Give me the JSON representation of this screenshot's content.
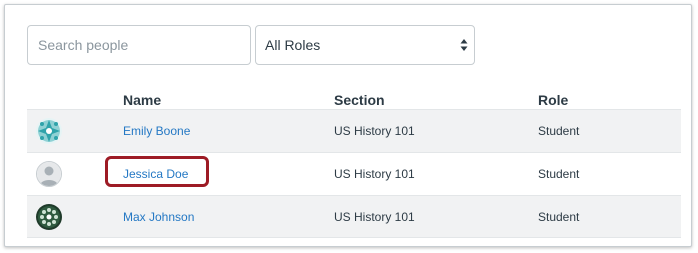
{
  "search": {
    "placeholder": "Search people",
    "value": ""
  },
  "role_filter": {
    "selected": "All Roles"
  },
  "table": {
    "headers": {
      "name": "Name",
      "section": "Section",
      "role": "Role"
    },
    "rows": [
      {
        "avatar": "avatar-teal-pattern-icon",
        "name": "Emily Boone",
        "section": "US History 101",
        "role": "Student"
      },
      {
        "avatar": "avatar-default-person-icon",
        "name": "Jessica Doe",
        "section": "US History 101",
        "role": "Student"
      },
      {
        "avatar": "avatar-green-pattern-icon",
        "name": "Max Johnson",
        "section": "US History 101",
        "role": "Student"
      }
    ]
  },
  "colors": {
    "link": "#2478c4",
    "highlight": "#9d1b25",
    "row_shade": "#f1f2f3"
  }
}
